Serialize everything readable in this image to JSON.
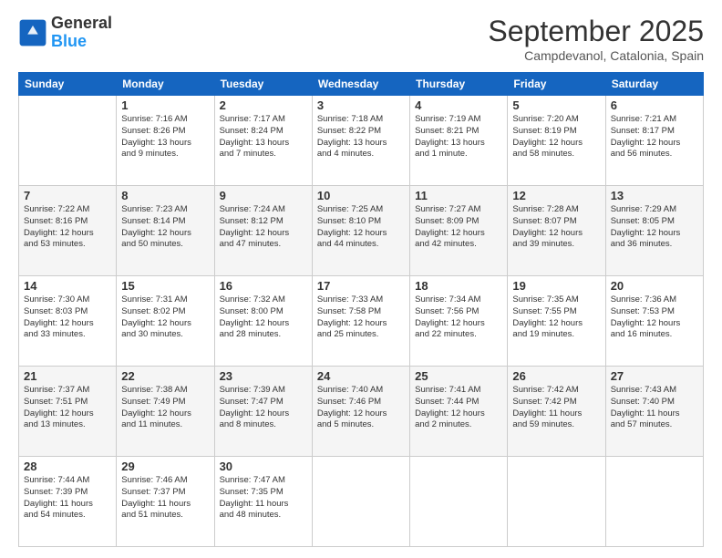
{
  "logo": {
    "general": "General",
    "blue": "Blue"
  },
  "header": {
    "month": "September 2025",
    "location": "Campdevanol, Catalonia, Spain"
  },
  "days_of_week": [
    "Sunday",
    "Monday",
    "Tuesday",
    "Wednesday",
    "Thursday",
    "Friday",
    "Saturday"
  ],
  "weeks": [
    [
      {
        "day": "",
        "info": ""
      },
      {
        "day": "1",
        "info": "Sunrise: 7:16 AM\nSunset: 8:26 PM\nDaylight: 13 hours\nand 9 minutes."
      },
      {
        "day": "2",
        "info": "Sunrise: 7:17 AM\nSunset: 8:24 PM\nDaylight: 13 hours\nand 7 minutes."
      },
      {
        "day": "3",
        "info": "Sunrise: 7:18 AM\nSunset: 8:22 PM\nDaylight: 13 hours\nand 4 minutes."
      },
      {
        "day": "4",
        "info": "Sunrise: 7:19 AM\nSunset: 8:21 PM\nDaylight: 13 hours\nand 1 minute."
      },
      {
        "day": "5",
        "info": "Sunrise: 7:20 AM\nSunset: 8:19 PM\nDaylight: 12 hours\nand 58 minutes."
      },
      {
        "day": "6",
        "info": "Sunrise: 7:21 AM\nSunset: 8:17 PM\nDaylight: 12 hours\nand 56 minutes."
      }
    ],
    [
      {
        "day": "7",
        "info": "Sunrise: 7:22 AM\nSunset: 8:16 PM\nDaylight: 12 hours\nand 53 minutes."
      },
      {
        "day": "8",
        "info": "Sunrise: 7:23 AM\nSunset: 8:14 PM\nDaylight: 12 hours\nand 50 minutes."
      },
      {
        "day": "9",
        "info": "Sunrise: 7:24 AM\nSunset: 8:12 PM\nDaylight: 12 hours\nand 47 minutes."
      },
      {
        "day": "10",
        "info": "Sunrise: 7:25 AM\nSunset: 8:10 PM\nDaylight: 12 hours\nand 44 minutes."
      },
      {
        "day": "11",
        "info": "Sunrise: 7:27 AM\nSunset: 8:09 PM\nDaylight: 12 hours\nand 42 minutes."
      },
      {
        "day": "12",
        "info": "Sunrise: 7:28 AM\nSunset: 8:07 PM\nDaylight: 12 hours\nand 39 minutes."
      },
      {
        "day": "13",
        "info": "Sunrise: 7:29 AM\nSunset: 8:05 PM\nDaylight: 12 hours\nand 36 minutes."
      }
    ],
    [
      {
        "day": "14",
        "info": "Sunrise: 7:30 AM\nSunset: 8:03 PM\nDaylight: 12 hours\nand 33 minutes."
      },
      {
        "day": "15",
        "info": "Sunrise: 7:31 AM\nSunset: 8:02 PM\nDaylight: 12 hours\nand 30 minutes."
      },
      {
        "day": "16",
        "info": "Sunrise: 7:32 AM\nSunset: 8:00 PM\nDaylight: 12 hours\nand 28 minutes."
      },
      {
        "day": "17",
        "info": "Sunrise: 7:33 AM\nSunset: 7:58 PM\nDaylight: 12 hours\nand 25 minutes."
      },
      {
        "day": "18",
        "info": "Sunrise: 7:34 AM\nSunset: 7:56 PM\nDaylight: 12 hours\nand 22 minutes."
      },
      {
        "day": "19",
        "info": "Sunrise: 7:35 AM\nSunset: 7:55 PM\nDaylight: 12 hours\nand 19 minutes."
      },
      {
        "day": "20",
        "info": "Sunrise: 7:36 AM\nSunset: 7:53 PM\nDaylight: 12 hours\nand 16 minutes."
      }
    ],
    [
      {
        "day": "21",
        "info": "Sunrise: 7:37 AM\nSunset: 7:51 PM\nDaylight: 12 hours\nand 13 minutes."
      },
      {
        "day": "22",
        "info": "Sunrise: 7:38 AM\nSunset: 7:49 PM\nDaylight: 12 hours\nand 11 minutes."
      },
      {
        "day": "23",
        "info": "Sunrise: 7:39 AM\nSunset: 7:47 PM\nDaylight: 12 hours\nand 8 minutes."
      },
      {
        "day": "24",
        "info": "Sunrise: 7:40 AM\nSunset: 7:46 PM\nDaylight: 12 hours\nand 5 minutes."
      },
      {
        "day": "25",
        "info": "Sunrise: 7:41 AM\nSunset: 7:44 PM\nDaylight: 12 hours\nand 2 minutes."
      },
      {
        "day": "26",
        "info": "Sunrise: 7:42 AM\nSunset: 7:42 PM\nDaylight: 11 hours\nand 59 minutes."
      },
      {
        "day": "27",
        "info": "Sunrise: 7:43 AM\nSunset: 7:40 PM\nDaylight: 11 hours\nand 57 minutes."
      }
    ],
    [
      {
        "day": "28",
        "info": "Sunrise: 7:44 AM\nSunset: 7:39 PM\nDaylight: 11 hours\nand 54 minutes."
      },
      {
        "day": "29",
        "info": "Sunrise: 7:46 AM\nSunset: 7:37 PM\nDaylight: 11 hours\nand 51 minutes."
      },
      {
        "day": "30",
        "info": "Sunrise: 7:47 AM\nSunset: 7:35 PM\nDaylight: 11 hours\nand 48 minutes."
      },
      {
        "day": "",
        "info": ""
      },
      {
        "day": "",
        "info": ""
      },
      {
        "day": "",
        "info": ""
      },
      {
        "day": "",
        "info": ""
      }
    ]
  ]
}
